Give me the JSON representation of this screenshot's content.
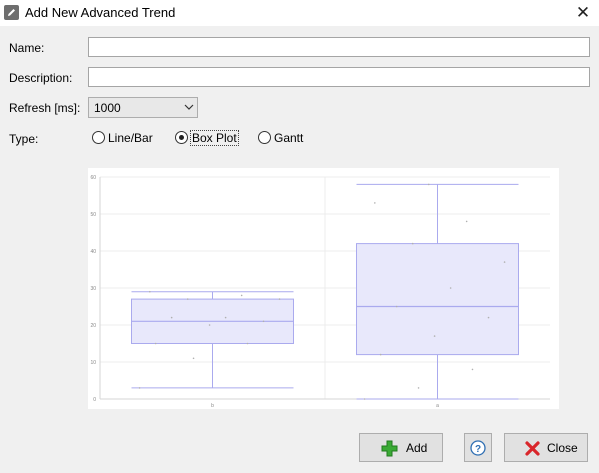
{
  "window": {
    "title": "Add New Advanced Trend",
    "icon": "pencil-icon",
    "close_icon": "close-icon"
  },
  "form": {
    "name_label": "Name:",
    "name_value": "",
    "description_label": "Description:",
    "description_value": "",
    "refresh_label": "Refresh [ms]:",
    "refresh_value": "1000",
    "type_label": "Type:",
    "type_options": [
      {
        "label": "Line/Bar",
        "selected": false
      },
      {
        "label": "Box Plot",
        "selected": true
      },
      {
        "label": "Gantt",
        "selected": false
      }
    ]
  },
  "chart_data": {
    "type": "box",
    "categories": [
      "b",
      "a"
    ],
    "y_ticks": [
      0,
      10,
      20,
      30,
      40,
      50,
      60
    ],
    "ylim": [
      0,
      60
    ],
    "grid": true,
    "box_color": "#aaaaee",
    "boxes": [
      {
        "category": "b",
        "min": 3,
        "q1": 15,
        "median": 21,
        "q3": 27,
        "max": 29,
        "points": [
          3,
          11,
          15,
          15,
          20,
          21,
          22,
          22,
          27,
          27,
          28,
          29
        ]
      },
      {
        "category": "a",
        "min": 0,
        "q1": 12,
        "median": 25,
        "q3": 42,
        "max": 58,
        "points": [
          0,
          3,
          8,
          12,
          17,
          22,
          25,
          30,
          37,
          42,
          48,
          53,
          58
        ]
      }
    ]
  },
  "buttons": {
    "add_label": "Add",
    "add_icon": "plus-icon",
    "help_icon": "question-icon",
    "close_label": "Close",
    "close_icon": "red-x-icon"
  }
}
